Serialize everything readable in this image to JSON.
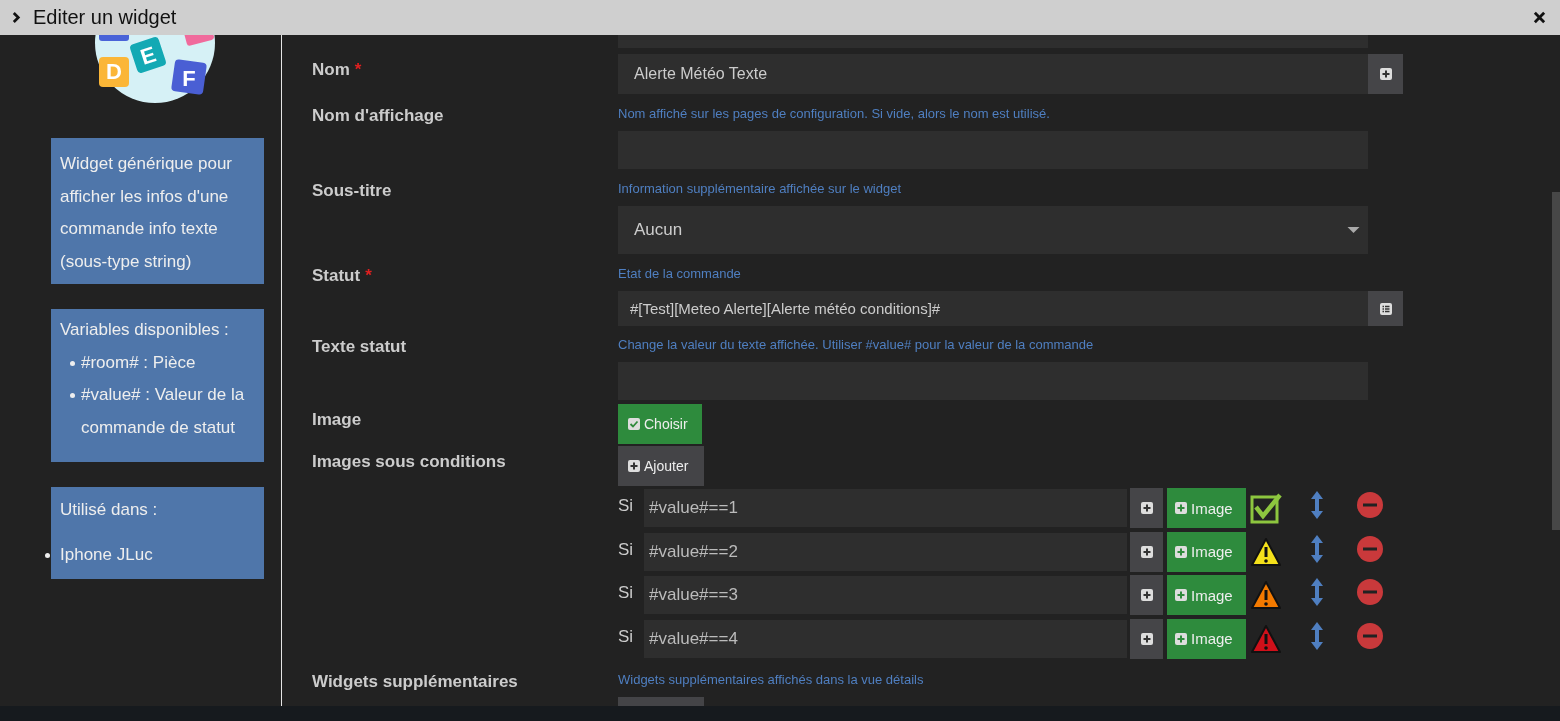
{
  "dialog": {
    "title": "Editer un widget"
  },
  "sidebar": {
    "logo_letters": [
      "D",
      "E",
      "F"
    ],
    "description": "Widget générique pour afficher les infos d'une commande info texte (sous-type string)",
    "variables": {
      "heading": "Variables disponibles :",
      "items": [
        "#room# : Pièce",
        "#value# : Valeur de la commande de statut"
      ]
    },
    "used_in": {
      "heading": "Utilisé dans :",
      "items": [
        "Iphone JLuc"
      ]
    }
  },
  "form": [
    {
      "kind": "partial"
    },
    {
      "kind": "text",
      "label": "Nom",
      "required_mark": "*",
      "value": "Alerte Météo Texte",
      "addon": {
        "kind": "plus"
      }
    },
    {
      "kind": "text",
      "label": "Nom d'affichage",
      "help": "Nom affiché sur les pages de configuration. Si vide, alors le nom est utilisé."
    },
    {
      "kind": "select",
      "label": "Sous-titre",
      "help": "Information supplémentaire affichée sur le widget",
      "value": "Aucun"
    },
    {
      "kind": "text",
      "label": "Statut",
      "required_mark": "*",
      "help": "Etat de la commande",
      "value": "#[Test][Meteo Alerte][Alerte météo conditions]#",
      "addon": {
        "kind": "list"
      }
    },
    {
      "kind": "text",
      "label": "Texte statut",
      "help": "Change la valeur du texte affichée. Utiliser #value# pour la valeur de la commande"
    },
    {
      "kind": "button",
      "label": "Image",
      "button": "Choisir"
    },
    {
      "kind": "conditions",
      "label": "Images sous conditions",
      "button": "Ajouter",
      "rows": [
        {
          "prefix": "Si",
          "value": "#value#==1",
          "image_button": "Image",
          "icon": {
            "kind": "check",
            "color": "#8dc63f"
          }
        },
        {
          "prefix": "Si",
          "value": "#value#==2",
          "image_button": "Image",
          "icon": {
            "kind": "warning",
            "color": "#f5e11b"
          }
        },
        {
          "prefix": "Si",
          "value": "#value#==3",
          "image_button": "Image",
          "icon": {
            "kind": "warning",
            "color": "#f47a00"
          }
        },
        {
          "prefix": "Si",
          "value": "#value#==4",
          "image_button": "Image",
          "icon": {
            "kind": "warning",
            "color": "#d0101a"
          }
        }
      ]
    },
    {
      "kind": "cutbutton",
      "label": "Widgets supplémentaires",
      "help": "Widgets supplémentaires affichés dans la vue détails"
    }
  ]
}
